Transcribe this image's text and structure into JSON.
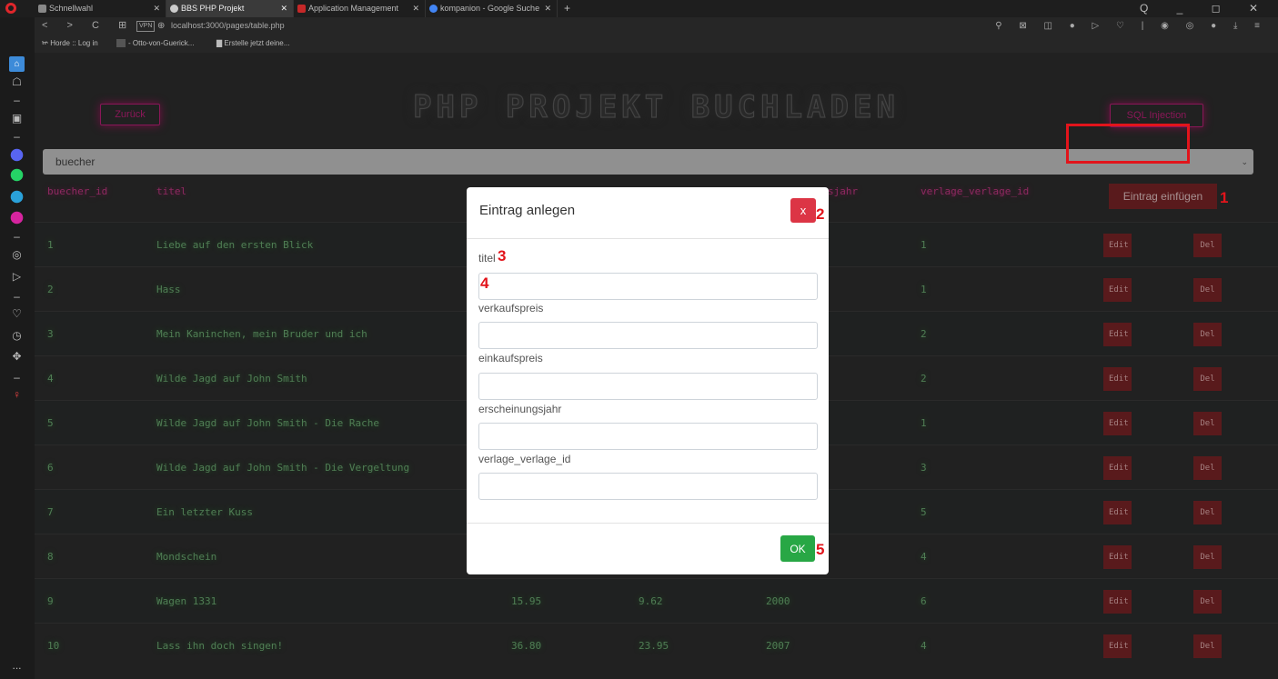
{
  "browser": {
    "tabs": [
      {
        "label": "Schnellwahl",
        "favicon_color": "#888888"
      },
      {
        "label": "BBS PHP Projekt",
        "favicon_color": "#cccccc"
      },
      {
        "label": "Application Management",
        "favicon_color": "#c62828"
      },
      {
        "label": "kompanion - Google Suche",
        "favicon_color": "#4285f4"
      }
    ],
    "new_tab_label": "+",
    "address": {
      "badge": "VPN",
      "url": "localhost:3000/pages/table.php"
    },
    "bookmarks": [
      "Horde :: Log in",
      "- Otto-von-Guerick...",
      "Erstelle jetzt deine..."
    ],
    "window_controls": "Q _ ◻ ✕",
    "more_label": "..."
  },
  "page": {
    "title": "PHP PROJEKT BUCHLADEN",
    "back_label": "Zurück",
    "sql_label": "SQL Injection",
    "table_select": "buecher",
    "insert_label": "Eintrag einfügen",
    "edit_label": "Edit",
    "delete_label": "Del",
    "headers": [
      "buecher_id",
      "titel",
      "",
      "",
      "sjahr",
      "verlage_verlage_id"
    ],
    "rows": [
      {
        "id": "1",
        "titel": "Liebe auf den ersten Blick",
        "vk": "",
        "ek": "",
        "jahr": "",
        "verlag": "1"
      },
      {
        "id": "2",
        "titel": "Hass",
        "vk": "",
        "ek": "",
        "jahr": "",
        "verlag": "1"
      },
      {
        "id": "3",
        "titel": "Mein Kaninchen, mein Bruder und ich",
        "vk": "",
        "ek": "",
        "jahr": "",
        "verlag": "2"
      },
      {
        "id": "4",
        "titel": "Wilde Jagd auf John Smith",
        "vk": "",
        "ek": "",
        "jahr": "",
        "verlag": "2"
      },
      {
        "id": "5",
        "titel": "Wilde Jagd auf John Smith - Die Rache",
        "vk": "",
        "ek": "",
        "jahr": "",
        "verlag": "1"
      },
      {
        "id": "6",
        "titel": "Wilde Jagd auf John Smith - Die Vergeltung",
        "vk": "",
        "ek": "",
        "jahr": "",
        "verlag": "3"
      },
      {
        "id": "7",
        "titel": "Ein letzter Kuss",
        "vk": "",
        "ek": "",
        "jahr": "",
        "verlag": "5"
      },
      {
        "id": "8",
        "titel": "Mondschein",
        "vk": "",
        "ek": "",
        "jahr": "",
        "verlag": "4"
      },
      {
        "id": "9",
        "titel": "Wagen 1331",
        "vk": "15.95",
        "ek": "9.62",
        "jahr": "2000",
        "verlag": "6"
      },
      {
        "id": "10",
        "titel": "Lass ihn doch singen!",
        "vk": "36.80",
        "ek": "23.95",
        "jahr": "2007",
        "verlag": "4"
      }
    ]
  },
  "modal": {
    "title": "Eintrag anlegen",
    "close_label": "x",
    "fields": [
      {
        "label": "titel",
        "value": ""
      },
      {
        "label": "verkaufspreis",
        "value": ""
      },
      {
        "label": "einkaufspreis",
        "value": ""
      },
      {
        "label": "erscheinungsjahr",
        "value": ""
      },
      {
        "label": "verlage_verlage_id",
        "value": ""
      }
    ],
    "ok_label": "OK"
  },
  "annotations": [
    "1",
    "2",
    "3",
    "4",
    "5"
  ],
  "colors": {
    "accent": "#c0217a",
    "danger": "#dc3545",
    "success": "#28a745",
    "highlight": "#e2141b"
  }
}
